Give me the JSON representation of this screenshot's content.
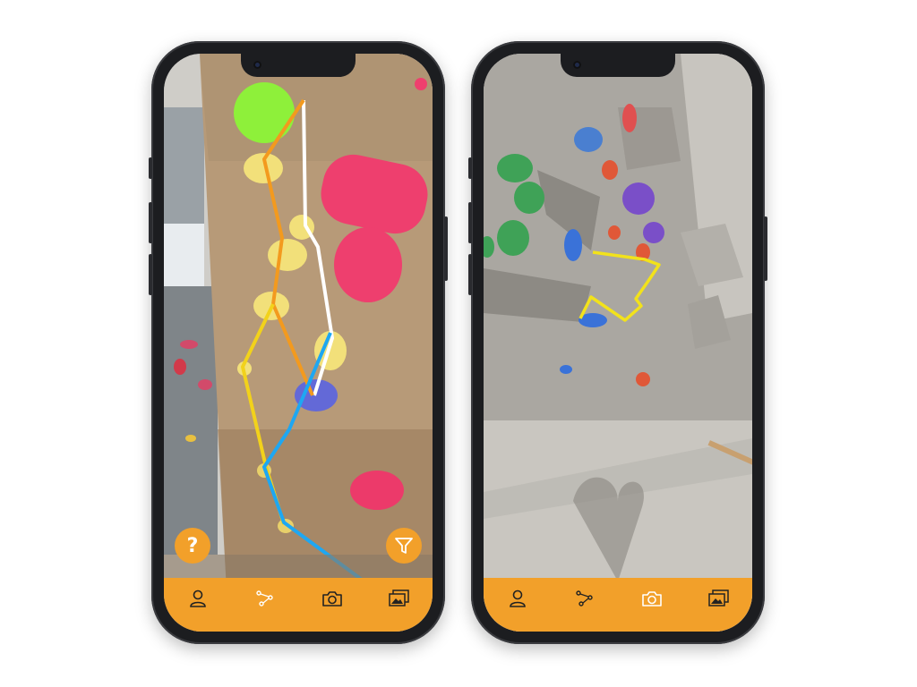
{
  "screens": [
    {
      "id": "left",
      "help_label": "?",
      "tabs": [
        {
          "icon": "person-icon"
        },
        {
          "icon": "route-icon"
        },
        {
          "icon": "camera-icon"
        },
        {
          "icon": "gallery-icon"
        }
      ],
      "filter_icon": "filter-icon",
      "colors": {
        "tabbar": "#f2a02a",
        "route_white": "#ffffff",
        "route_orange": "#f39a1e",
        "route_yellow": "#f2d21b",
        "route_blue": "#1ea7f2"
      }
    },
    {
      "id": "right",
      "tabs": [
        {
          "icon": "person-icon"
        },
        {
          "icon": "route-icon"
        },
        {
          "icon": "camera-icon"
        },
        {
          "icon": "gallery-icon"
        }
      ],
      "colors": {
        "tabbar": "#f2a02a",
        "route_yellow": "#f2e21b"
      }
    }
  ]
}
